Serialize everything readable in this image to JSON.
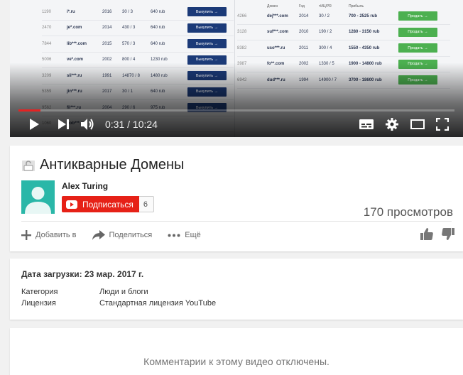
{
  "player": {
    "time_current": "0:31",
    "time_separator": " / ",
    "time_total": "10:24",
    "progress": 0.05,
    "icons": [
      "play-icon",
      "next-icon",
      "volume-icon",
      "subtitles-icon",
      "settings-icon",
      "theater-mode-icon",
      "fullscreen-icon"
    ],
    "frame": {
      "left_rows": [
        {
          "id": "1190",
          "domain": "i*.ru",
          "year": "2016",
          "tic": "30 / 3",
          "price": "640 rub",
          "button": "Выкупить →"
        },
        {
          "id": "2470",
          "domain": "je*.com",
          "year": "2014",
          "tic": "430 / 3",
          "price": "640 rub",
          "button": "Выкупить →"
        },
        {
          "id": "7844",
          "domain": "lib***.com",
          "year": "2015",
          "tic": "570 / 3",
          "price": "640 rub",
          "button": "Выкупить →"
        },
        {
          "id": "5006",
          "domain": "ve*.com",
          "year": "2002",
          "tic": "800 / 4",
          "price": "1230 rub",
          "button": "Выкупить →"
        },
        {
          "id": "3209",
          "domain": "sli***.ru",
          "year": "1991",
          "tic": "14870 / 8",
          "price": "1480 rub",
          "button": "Выкупить →"
        },
        {
          "id": "5359",
          "domain": "jin***.ru",
          "year": "2017",
          "tic": "30 / 1",
          "price": "640 rub",
          "button": "Выкупить →"
        },
        {
          "id": "9562",
          "domain": "fil***.ru",
          "year": "2004",
          "tic": "290 / 6",
          "price": "975 rub",
          "button": "Выкупить →"
        },
        {
          "id": "1060",
          "domain": "pob***.ru",
          "year": "",
          "tic": "",
          "price": "",
          "button": ""
        }
      ],
      "right_header": [
        "",
        "Домен",
        "Год",
        "тИЦ/PR",
        "Прибыль"
      ],
      "right_rows": [
        {
          "id": "4266",
          "domain": "dej***.com",
          "year": "2014",
          "tic": "30 / 2",
          "profit": "700 - 2525 rub",
          "button": "Продать →"
        },
        {
          "id": "3128",
          "domain": "suf***.com",
          "year": "2010",
          "tic": "190 / 2",
          "profit": "1280 - 3150 rub",
          "button": "Продать →"
        },
        {
          "id": "8382",
          "domain": "uso***.ru",
          "year": "2011",
          "tic": "300 / 4",
          "profit": "1550 - 4350 rub",
          "button": "Продать →"
        },
        {
          "id": "3987",
          "domain": "fo**.com",
          "year": "2002",
          "tic": "1330 / 5",
          "profit": "1900 - 14800 rub",
          "button": "Продать →"
        },
        {
          "id": "6942",
          "domain": "dud***.ru",
          "year": "1994",
          "tic": "14900 / 7",
          "profit": "3700 - 18600 rub",
          "button": "Продать →"
        }
      ]
    }
  },
  "video": {
    "title": "Антикварные Домены",
    "channel": "Alex Turing",
    "subscribe_label": "Подписаться",
    "subscriber_count": "6",
    "views": "170 просмотров"
  },
  "actions": {
    "add": "Добавить в",
    "share": "Поделиться",
    "more": "Ещё"
  },
  "details": {
    "upload_date": "Дата загрузки: 23 мар. 2017 г.",
    "category_label": "Категория",
    "category_value": "Люди и блоги",
    "license_label": "Лицензия",
    "license_value": "Стандартная лицензия YouTube"
  },
  "comments": {
    "disabled_text": "Комментарии к этому видео отключены."
  },
  "colors": {
    "subscribe": "#e62117",
    "progress": "#e52222",
    "avatar": "#2ab7a8",
    "buy_button": "#1b3a78",
    "sell_button": "#4cb050"
  }
}
